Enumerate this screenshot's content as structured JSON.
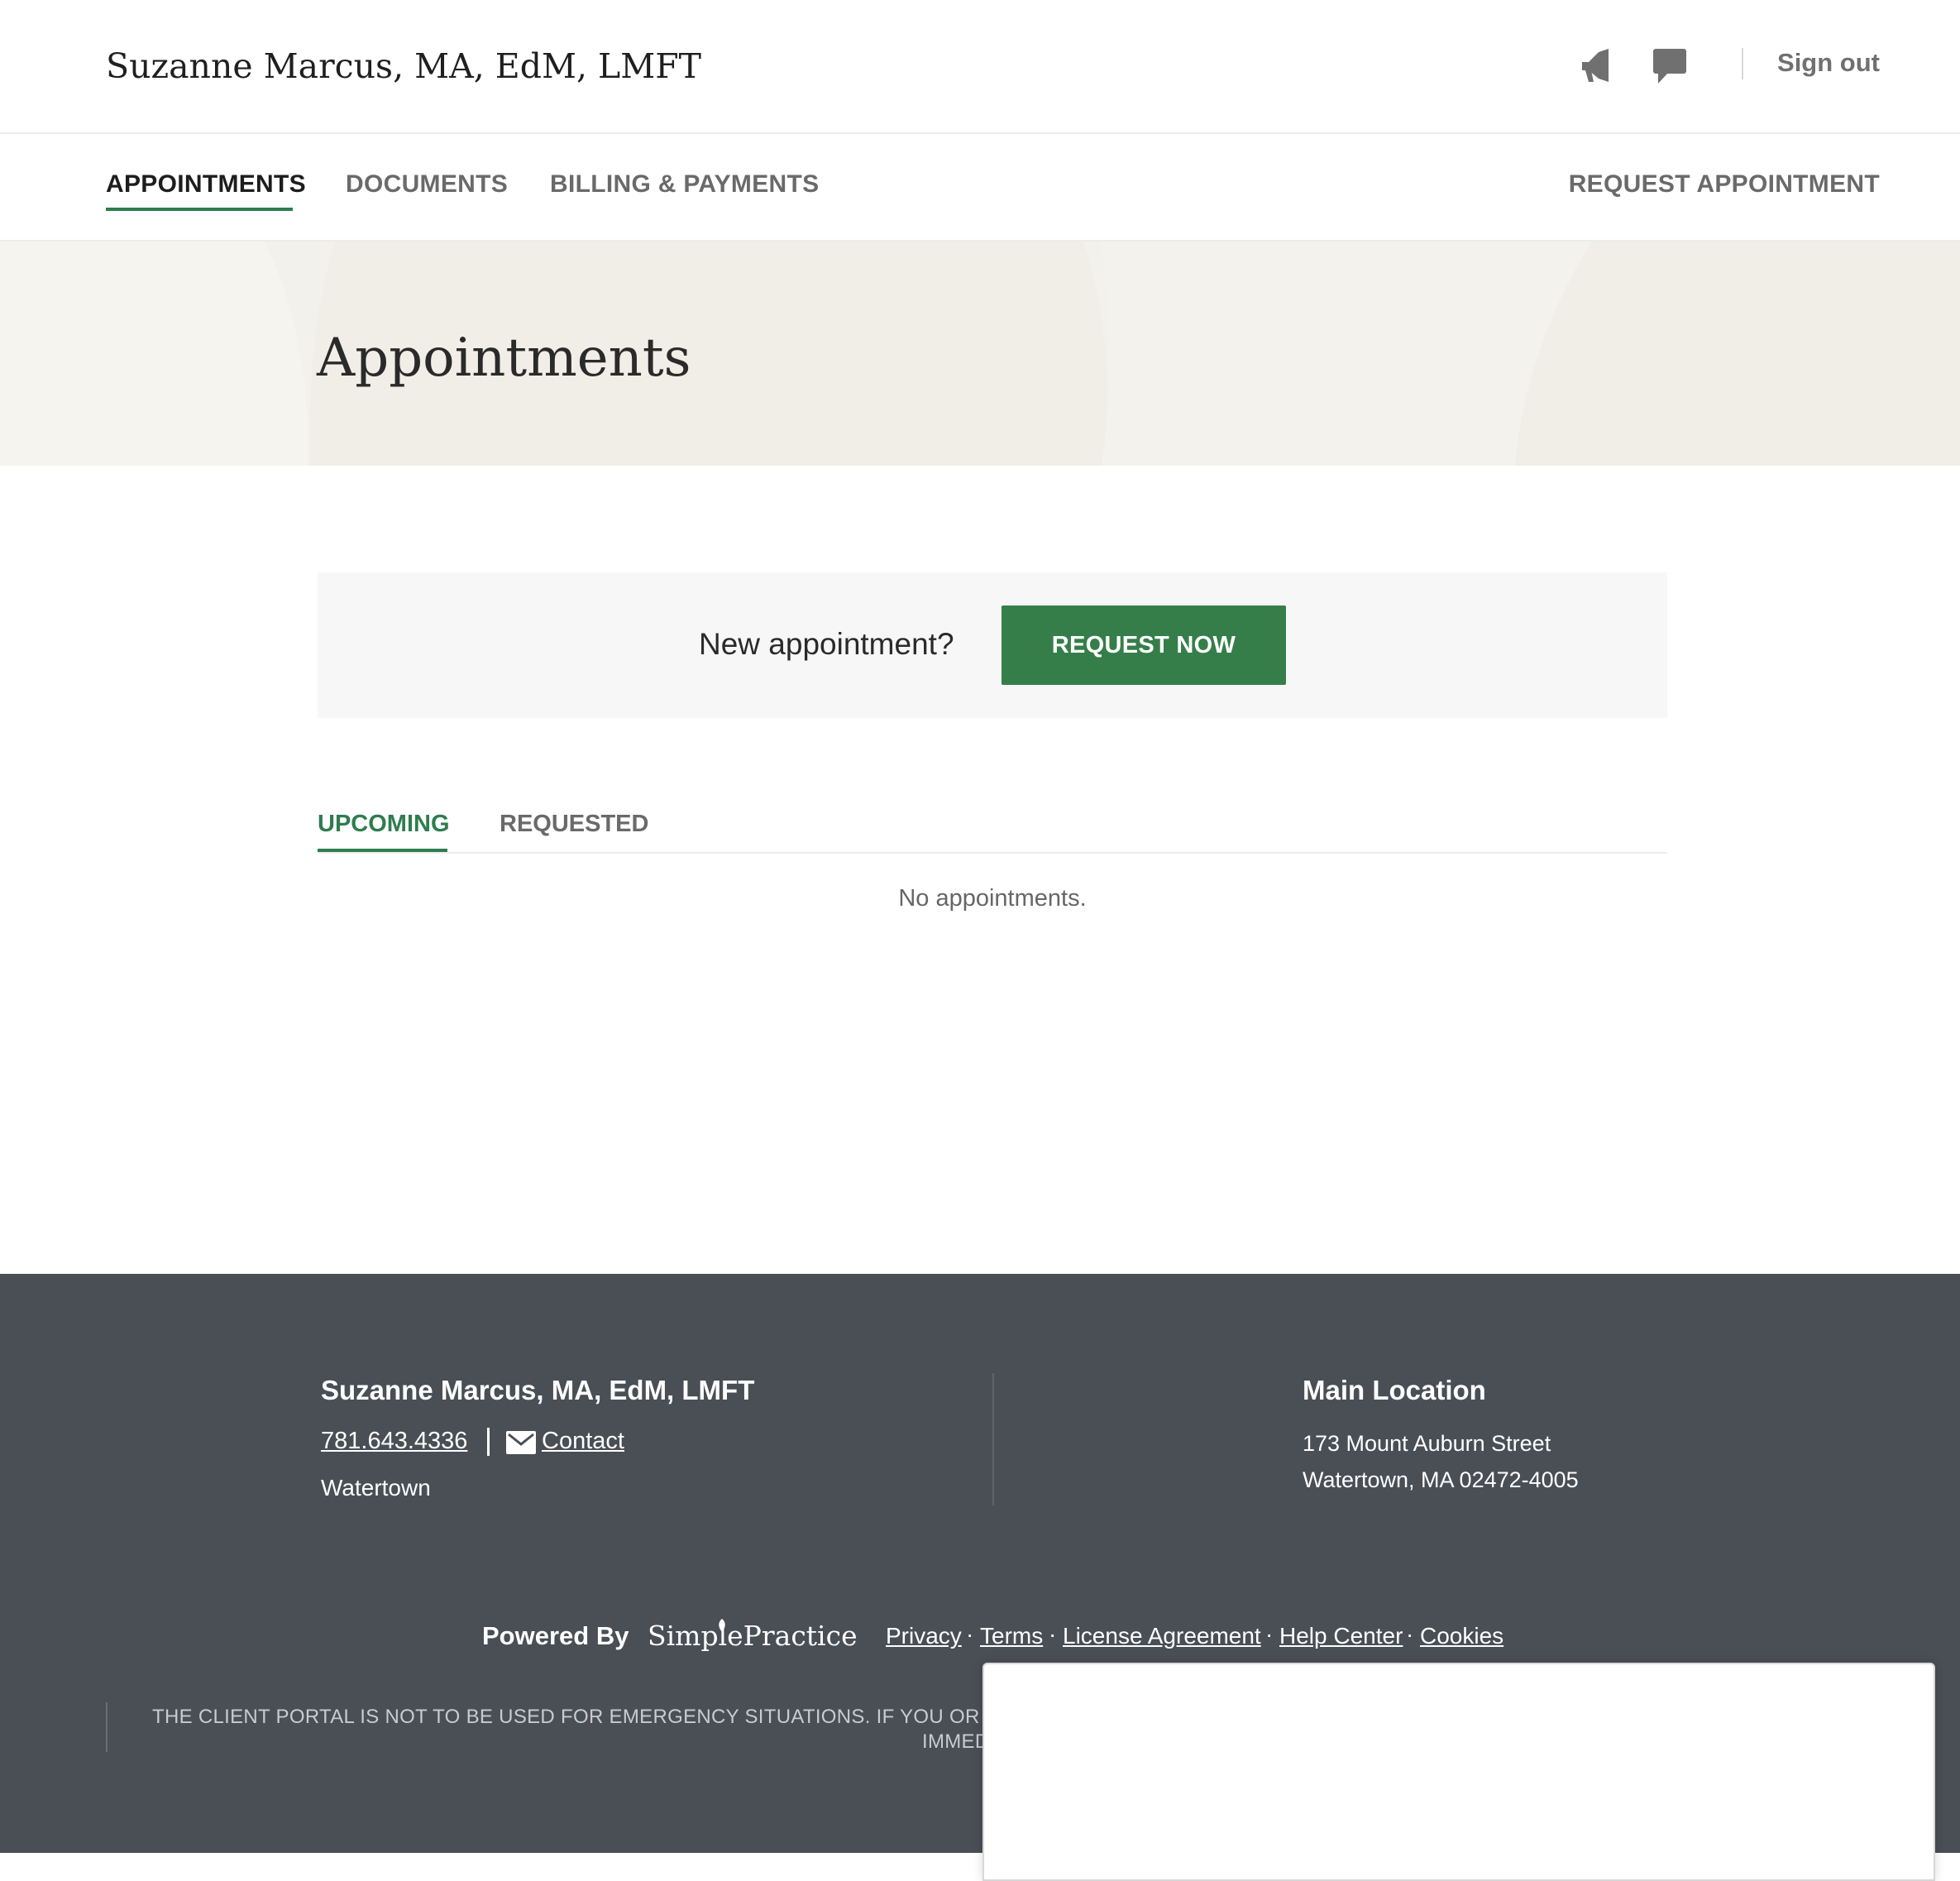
{
  "header": {
    "practice_name": "Suzanne Marcus, MA, EdM, LMFT",
    "icons": [
      "megaphone-icon",
      "chat-icon"
    ],
    "sign_out": "Sign out"
  },
  "nav": {
    "items": [
      {
        "label": "APPOINTMENTS",
        "active": true
      },
      {
        "label": "DOCUMENTS",
        "active": false
      },
      {
        "label": "BILLING & PAYMENTS",
        "active": false
      }
    ],
    "request_appointment": "REQUEST APPOINTMENT"
  },
  "hero": {
    "title": "Appointments"
  },
  "request": {
    "prompt": "New appointment?",
    "button": "REQUEST NOW"
  },
  "tabs": {
    "items": [
      {
        "label": "UPCOMING",
        "active": true
      },
      {
        "label": "REQUESTED",
        "active": false
      }
    ],
    "empty_message": "No appointments."
  },
  "footer": {
    "practice_name": "Suzanne Marcus, MA, EdM, LMFT",
    "phone": "781.643.4336",
    "contact": "Contact",
    "city": "Watertown",
    "location": {
      "title": "Main Location",
      "line1": "173 Mount Auburn Street",
      "line2": "Watertown, MA 02472-4005"
    },
    "powered_by": "Powered By",
    "brand": "SimplePractice",
    "links": [
      "Privacy",
      "Terms",
      "License Agreement",
      "Help Center",
      "Cookies"
    ],
    "disclaimer_line1": "THE CLIENT PORTAL IS NOT TO BE USED FOR EMERGENCY SITUATIONS. IF YOU OR OT",
    "disclaimer_line2": "IMMED"
  },
  "colors": {
    "accent_green": "#357e4a",
    "footer_bg": "#4a4e55",
    "hero_bg": "#f3f1eb"
  }
}
